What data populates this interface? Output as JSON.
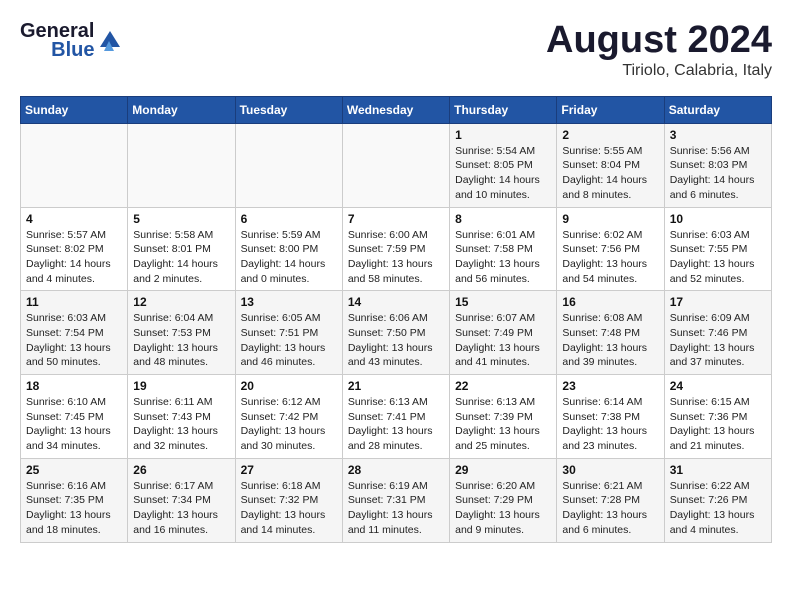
{
  "header": {
    "logo_line1": "General",
    "logo_line2": "Blue",
    "title": "August 2024",
    "location": "Tiriolo, Calabria, Italy"
  },
  "days_of_week": [
    "Sunday",
    "Monday",
    "Tuesday",
    "Wednesday",
    "Thursday",
    "Friday",
    "Saturday"
  ],
  "weeks": [
    [
      {
        "day": "",
        "info": ""
      },
      {
        "day": "",
        "info": ""
      },
      {
        "day": "",
        "info": ""
      },
      {
        "day": "",
        "info": ""
      },
      {
        "day": "1",
        "info": "Sunrise: 5:54 AM\nSunset: 8:05 PM\nDaylight: 14 hours\nand 10 minutes."
      },
      {
        "day": "2",
        "info": "Sunrise: 5:55 AM\nSunset: 8:04 PM\nDaylight: 14 hours\nand 8 minutes."
      },
      {
        "day": "3",
        "info": "Sunrise: 5:56 AM\nSunset: 8:03 PM\nDaylight: 14 hours\nand 6 minutes."
      }
    ],
    [
      {
        "day": "4",
        "info": "Sunrise: 5:57 AM\nSunset: 8:02 PM\nDaylight: 14 hours\nand 4 minutes."
      },
      {
        "day": "5",
        "info": "Sunrise: 5:58 AM\nSunset: 8:01 PM\nDaylight: 14 hours\nand 2 minutes."
      },
      {
        "day": "6",
        "info": "Sunrise: 5:59 AM\nSunset: 8:00 PM\nDaylight: 14 hours\nand 0 minutes."
      },
      {
        "day": "7",
        "info": "Sunrise: 6:00 AM\nSunset: 7:59 PM\nDaylight: 13 hours\nand 58 minutes."
      },
      {
        "day": "8",
        "info": "Sunrise: 6:01 AM\nSunset: 7:58 PM\nDaylight: 13 hours\nand 56 minutes."
      },
      {
        "day": "9",
        "info": "Sunrise: 6:02 AM\nSunset: 7:56 PM\nDaylight: 13 hours\nand 54 minutes."
      },
      {
        "day": "10",
        "info": "Sunrise: 6:03 AM\nSunset: 7:55 PM\nDaylight: 13 hours\nand 52 minutes."
      }
    ],
    [
      {
        "day": "11",
        "info": "Sunrise: 6:03 AM\nSunset: 7:54 PM\nDaylight: 13 hours\nand 50 minutes."
      },
      {
        "day": "12",
        "info": "Sunrise: 6:04 AM\nSunset: 7:53 PM\nDaylight: 13 hours\nand 48 minutes."
      },
      {
        "day": "13",
        "info": "Sunrise: 6:05 AM\nSunset: 7:51 PM\nDaylight: 13 hours\nand 46 minutes."
      },
      {
        "day": "14",
        "info": "Sunrise: 6:06 AM\nSunset: 7:50 PM\nDaylight: 13 hours\nand 43 minutes."
      },
      {
        "day": "15",
        "info": "Sunrise: 6:07 AM\nSunset: 7:49 PM\nDaylight: 13 hours\nand 41 minutes."
      },
      {
        "day": "16",
        "info": "Sunrise: 6:08 AM\nSunset: 7:48 PM\nDaylight: 13 hours\nand 39 minutes."
      },
      {
        "day": "17",
        "info": "Sunrise: 6:09 AM\nSunset: 7:46 PM\nDaylight: 13 hours\nand 37 minutes."
      }
    ],
    [
      {
        "day": "18",
        "info": "Sunrise: 6:10 AM\nSunset: 7:45 PM\nDaylight: 13 hours\nand 34 minutes."
      },
      {
        "day": "19",
        "info": "Sunrise: 6:11 AM\nSunset: 7:43 PM\nDaylight: 13 hours\nand 32 minutes."
      },
      {
        "day": "20",
        "info": "Sunrise: 6:12 AM\nSunset: 7:42 PM\nDaylight: 13 hours\nand 30 minutes."
      },
      {
        "day": "21",
        "info": "Sunrise: 6:13 AM\nSunset: 7:41 PM\nDaylight: 13 hours\nand 28 minutes."
      },
      {
        "day": "22",
        "info": "Sunrise: 6:13 AM\nSunset: 7:39 PM\nDaylight: 13 hours\nand 25 minutes."
      },
      {
        "day": "23",
        "info": "Sunrise: 6:14 AM\nSunset: 7:38 PM\nDaylight: 13 hours\nand 23 minutes."
      },
      {
        "day": "24",
        "info": "Sunrise: 6:15 AM\nSunset: 7:36 PM\nDaylight: 13 hours\nand 21 minutes."
      }
    ],
    [
      {
        "day": "25",
        "info": "Sunrise: 6:16 AM\nSunset: 7:35 PM\nDaylight: 13 hours\nand 18 minutes."
      },
      {
        "day": "26",
        "info": "Sunrise: 6:17 AM\nSunset: 7:34 PM\nDaylight: 13 hours\nand 16 minutes."
      },
      {
        "day": "27",
        "info": "Sunrise: 6:18 AM\nSunset: 7:32 PM\nDaylight: 13 hours\nand 14 minutes."
      },
      {
        "day": "28",
        "info": "Sunrise: 6:19 AM\nSunset: 7:31 PM\nDaylight: 13 hours\nand 11 minutes."
      },
      {
        "day": "29",
        "info": "Sunrise: 6:20 AM\nSunset: 7:29 PM\nDaylight: 13 hours\nand 9 minutes."
      },
      {
        "day": "30",
        "info": "Sunrise: 6:21 AM\nSunset: 7:28 PM\nDaylight: 13 hours\nand 6 minutes."
      },
      {
        "day": "31",
        "info": "Sunrise: 6:22 AM\nSunset: 7:26 PM\nDaylight: 13 hours\nand 4 minutes."
      }
    ]
  ]
}
